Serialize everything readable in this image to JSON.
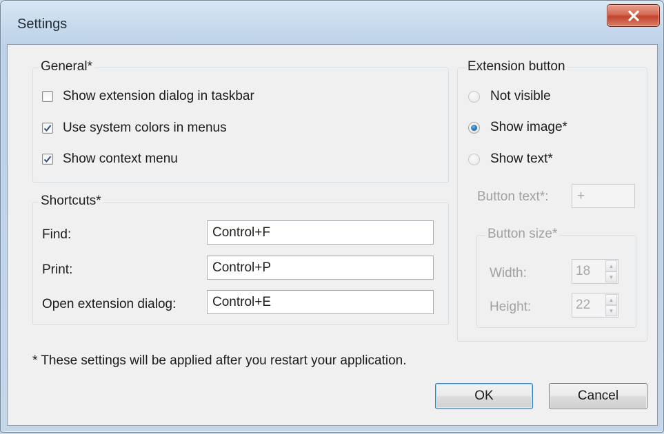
{
  "window": {
    "title": "Settings",
    "close_icon": "close-x-icon"
  },
  "general": {
    "legend": "General*",
    "options": [
      {
        "label": "Show extension dialog in taskbar",
        "checked": false
      },
      {
        "label": "Use system colors in menus",
        "checked": true
      },
      {
        "label": "Show context menu",
        "checked": true
      }
    ]
  },
  "shortcuts": {
    "legend": "Shortcuts*",
    "find_label": "Find:",
    "find_value": "Control+F",
    "print_label": "Print:",
    "print_value": "Control+P",
    "open_label": "Open extension dialog:",
    "open_value": "Control+E"
  },
  "extension_button": {
    "legend": "Extension button",
    "options": [
      {
        "label": "Not visible",
        "selected": false
      },
      {
        "label": "Show image*",
        "selected": true
      },
      {
        "label": "Show text*",
        "selected": false
      }
    ],
    "button_text_label": "Button text*:",
    "button_text_value": "+",
    "button_size": {
      "legend": "Button size*",
      "width_label": "Width:",
      "width_value": "18",
      "height_label": "Height:",
      "height_value": "22"
    }
  },
  "footnote": "* These settings will be applied after you restart your application.",
  "buttons": {
    "ok": "OK",
    "cancel": "Cancel"
  }
}
